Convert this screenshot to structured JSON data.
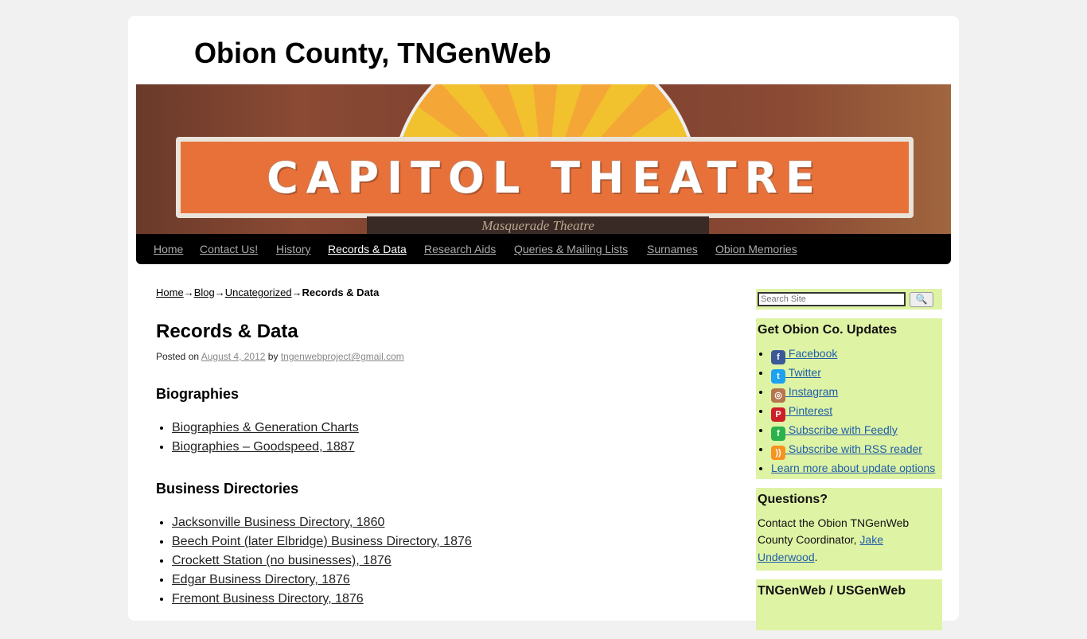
{
  "site_title": "Obion County, TNGenWeb",
  "banner": {
    "marquee_text": "CAPITOL THEATRE",
    "underside_text": "Masquerade Theatre"
  },
  "nav": [
    {
      "label": "Home"
    },
    {
      "label": "Contact Us!"
    },
    {
      "label": "History"
    },
    {
      "label": "Records & Data",
      "current": true
    },
    {
      "label": "Research Aids"
    },
    {
      "label": "Queries & Mailing Lists"
    },
    {
      "label": "Surnames"
    },
    {
      "label": "Obion Memories"
    }
  ],
  "breadcrumb": {
    "items": [
      "Home",
      "Blog",
      "Uncategorized"
    ],
    "current": "Records & Data",
    "separator": "→"
  },
  "post": {
    "title": "Records & Data",
    "posted_on": "Posted on",
    "date": "August 4, 2012",
    "by": "by",
    "author": "tngenwebproject@gmail.com"
  },
  "sections": [
    {
      "heading": "Biographies",
      "links": [
        "Biographies & Generation Charts",
        "Biographies – Goodspeed, 1887"
      ]
    },
    {
      "heading": "Business Directories",
      "links": [
        "Jacksonville Business Directory, 1860",
        "Beech Point (later Elbridge) Business Directory, 1876",
        "Crockett Station (no businesses), 1876",
        "Edgar Business Directory, 1876",
        "Fremont Business Directory, 1876"
      ]
    }
  ],
  "sidebar": {
    "search_placeholder": "Search Site",
    "updates": {
      "title": "Get Obion Co. Updates",
      "items": [
        {
          "label": " Facebook",
          "icon": "facebook-icon",
          "color": "#3b5998"
        },
        {
          "label": " Twitter",
          "icon": "twitter-icon",
          "color": "#1da1f2"
        },
        {
          "label": " Instagram",
          "icon": "instagram-icon",
          "color": "#b5754f"
        },
        {
          "label": " Pinterest",
          "icon": "pinterest-icon",
          "color": "#cb2027"
        },
        {
          "label": " Subscribe with Feedly",
          "icon": "feedly-icon",
          "color": "#2bb24c"
        },
        {
          "label": " Subscribe with RSS reader",
          "icon": "rss-icon",
          "color": "#f7931e"
        }
      ],
      "learn_more": "Learn more about update options"
    },
    "questions": {
      "title": "Questions?",
      "text": "Contact the Obion TNGenWeb County Coordinator, ",
      "link": "Jake Underwood",
      "end": "."
    },
    "tngenweb": {
      "title": "TNGenWeb / USGenWeb"
    }
  },
  "colors": {
    "sidebar_bg": "#dff3a5",
    "nav_bg": "#000000",
    "link": "#1f5ea8"
  }
}
